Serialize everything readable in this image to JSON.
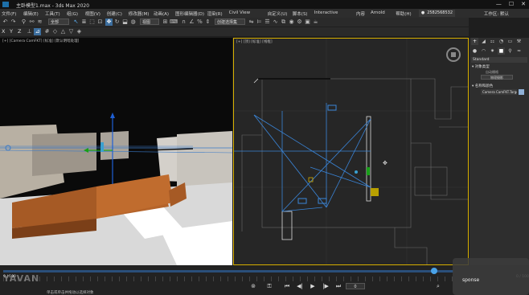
{
  "window": {
    "title": "主卧模型1.max - 3ds Max 2020",
    "minimize": "—",
    "maximize": "☐",
    "close": "✕"
  },
  "menu": {
    "items": [
      "文件(F)",
      "编辑(E)",
      "工具(T)",
      "组(G)",
      "视图(V)",
      "创建(C)",
      "修改器(M)",
      "动画(A)",
      "图形编辑器(D)",
      "渲染(R)",
      "Civil View",
      "自定义(U)",
      "脚本(S)",
      "Interactive",
      "内容",
      "Arnold",
      "帮助(H)"
    ],
    "account": "2582568532",
    "help": "工作区: 默认"
  },
  "toolbar": {
    "selection_filter": "全部",
    "reference_coord": "视图",
    "named_selection": "创建选择集"
  },
  "viewports": {
    "left_label": "[+] [Camera CamFKT] [标准] [默认明暗处理]",
    "right_label": "[+] [顶] [标准] [线框]"
  },
  "command_panel": {
    "name": "Standard",
    "rollout_type": "对象类型",
    "autogrid": "自动栅格",
    "camera_btn": "物理摄影",
    "rollout_name": "名称和颜色",
    "object_name": "Camera CamFKT.Target",
    "object_color": "#8fb0d6"
  },
  "timeline": {
    "start_label": "0 / 100",
    "end_label": "0 / 100",
    "current_frame": "0"
  },
  "status": {
    "prompt": "单击或单击并拖动以选择对象"
  },
  "overlay": {
    "watermark": "YAVAN",
    "webcam_label": "sponse"
  }
}
